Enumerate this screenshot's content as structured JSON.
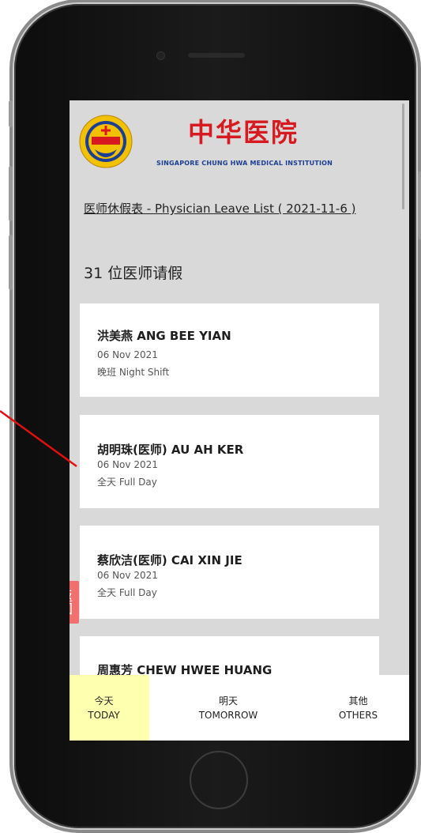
{
  "brand": {
    "name_cn": "中华医院",
    "name_en": "SINGAPORE CHUNG HWA MEDICAL INSTITUTION",
    "logo_icon": "chung-hwa-logo-icon",
    "accent_red": "#d71920",
    "accent_blue": "#1c3f95"
  },
  "page": {
    "title": "医师休假表 - Physician Leave List ( 2021-11-6 )",
    "count_label": "31 位医师请假"
  },
  "physicians": [
    {
      "name": "洪美燕 ANG BEE YIAN",
      "date": "06 Nov 2021",
      "shift": "晚班 Night Shift"
    },
    {
      "name": "胡明珠(医师) AU AH KER",
      "date": "06 Nov 2021",
      "shift": "全天 Full Day"
    },
    {
      "name": "蔡欣洁(医师) CAI XIN JIE",
      "date": "06 Nov 2021",
      "shift": "全天 Full Day"
    },
    {
      "name": "周惠芳 CHEW HWEE HUANG",
      "date": "",
      "shift": ""
    }
  ],
  "back_button": {
    "label": "返回",
    "color": "#f07070"
  },
  "nav": {
    "today_cn": "今天",
    "today_en": "TODAY",
    "tomorrow_cn": "明天",
    "tomorrow_en": "TOMORROW",
    "others_cn": "其他",
    "others_en": "OTHERS",
    "active_color": "#ffffb0"
  }
}
